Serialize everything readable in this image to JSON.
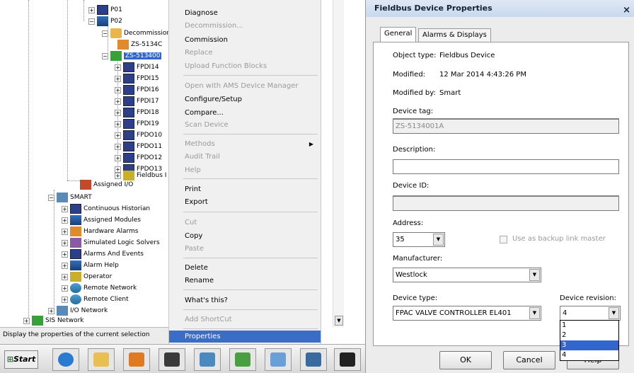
{
  "tree": {
    "items": [
      {
        "label": "P01",
        "icon": "computer-icon"
      },
      {
        "label": "P02",
        "icon": "controller-icon"
      },
      {
        "label": "Decommission",
        "icon": "folder-icon"
      },
      {
        "label": "ZS-5134C",
        "icon": "device-icon"
      },
      {
        "label": "ZS-513400",
        "icon": "device-icon"
      },
      {
        "label": "FPDI14",
        "icon": "function-block-icon"
      },
      {
        "label": "FPDI15",
        "icon": "function-block-icon"
      },
      {
        "label": "FPDI16",
        "icon": "function-block-icon"
      },
      {
        "label": "FPDI17",
        "icon": "function-block-icon"
      },
      {
        "label": "FPDI18",
        "icon": "function-block-icon"
      },
      {
        "label": "FPDI19",
        "icon": "function-block-icon"
      },
      {
        "label": "FPDO10",
        "icon": "function-block-icon"
      },
      {
        "label": "FPDO11",
        "icon": "function-block-icon"
      },
      {
        "label": "FPDO12",
        "icon": "function-block-icon"
      },
      {
        "label": "FPDO13",
        "icon": "function-block-icon"
      },
      {
        "label": "Fieldbus I",
        "icon": "fieldbus-icon"
      },
      {
        "label": "Assigned I/O",
        "icon": "assigned-io-icon"
      },
      {
        "label": "SMART",
        "icon": "node-icon"
      },
      {
        "label": "Continuous Historian",
        "icon": "historian-icon"
      },
      {
        "label": "Assigned Modules",
        "icon": "modules-icon"
      },
      {
        "label": "Hardware Alarms",
        "icon": "hardware-alarm-icon"
      },
      {
        "label": "Simulated Logic Solvers",
        "icon": "logic-solver-icon"
      },
      {
        "label": "Alarms And Events",
        "icon": "alarms-events-icon"
      },
      {
        "label": "Alarm Help",
        "icon": "alarm-help-icon"
      },
      {
        "label": "Operator",
        "icon": "operator-icon"
      },
      {
        "label": "Remote Network",
        "icon": "remote-network-icon"
      },
      {
        "label": "Remote Client",
        "icon": "remote-client-icon"
      },
      {
        "label": "I/O Network",
        "icon": "io-network-icon"
      },
      {
        "label": "SIS Network",
        "icon": "sis-network-icon"
      }
    ]
  },
  "context_menu": {
    "items": [
      {
        "label": "Diagnose",
        "enabled": true
      },
      {
        "label": "Decommission...",
        "enabled": false
      },
      {
        "label": "Commission",
        "enabled": true
      },
      {
        "label": "Replace",
        "enabled": false
      },
      {
        "label": "Upload Function Blocks",
        "enabled": false
      },
      {
        "label": "Open with AMS Device Manager",
        "enabled": false
      },
      {
        "label": "Configure/Setup",
        "enabled": true
      },
      {
        "label": "Compare...",
        "enabled": true
      },
      {
        "label": "Scan Device",
        "enabled": false
      },
      {
        "label": "Methods",
        "enabled": false
      },
      {
        "label": "Audit Trail",
        "enabled": false
      },
      {
        "label": "Help",
        "enabled": false
      },
      {
        "label": "Print",
        "enabled": true
      },
      {
        "label": "Export",
        "enabled": true
      },
      {
        "label": "Cut",
        "enabled": false
      },
      {
        "label": "Copy",
        "enabled": true
      },
      {
        "label": "Paste",
        "enabled": false
      },
      {
        "label": "Delete",
        "enabled": true
      },
      {
        "label": "Rename",
        "enabled": true
      },
      {
        "label": "What's this?",
        "enabled": true
      },
      {
        "label": "Add ShortCut",
        "enabled": false
      },
      {
        "label": "Properties",
        "enabled": true,
        "highlighted": true
      }
    ],
    "submenu_arrow": "▶"
  },
  "status_bar": {
    "text": "Display the properties of the current selection"
  },
  "taskbar": {
    "start_label": "Start",
    "buttons": [
      {
        "icon": "internet-explorer-icon"
      },
      {
        "icon": "file-explorer-icon"
      },
      {
        "icon": "media-player-icon"
      },
      {
        "icon": "delta-v-explorer-icon"
      },
      {
        "icon": "control-studio-icon"
      },
      {
        "icon": "diagnostics-icon"
      },
      {
        "icon": "ams-device-manager-icon"
      },
      {
        "icon": "network-icon"
      },
      {
        "icon": "trend-icon"
      }
    ]
  },
  "dialog": {
    "title": "Fieldbus Device Properties",
    "close_glyph": "×",
    "tabs": [
      "General",
      "Alarms & Displays"
    ],
    "object_type_label": "Object type:",
    "object_type_value": "Fieldbus Device",
    "modified_label": "Modified:",
    "modified_value": "12 Mar 2014 4:43:26 PM",
    "modified_by_label": "Modified by:",
    "modified_by_value": "Smart",
    "device_tag_label": "Device tag:",
    "device_tag_value": "ZS-5134001A",
    "description_label": "Description:",
    "description_value": "",
    "device_id_label": "Device ID:",
    "device_id_value": "",
    "address_label": "Address:",
    "address_value": "35",
    "backup_link_master_label": "Use as backup link master",
    "manufacturer_label": "Manufacturer:",
    "manufacturer_value": "Westlock",
    "device_type_label": "Device type:",
    "device_type_value": "FPAC VALVE CONTROLLER EL401",
    "device_revision_label": "Device revision:",
    "device_revision_value": "4",
    "device_revision_options": [
      "1",
      "2",
      "3",
      "4"
    ],
    "device_revision_highlighted": "3",
    "ok_label": "OK",
    "cancel_label": "Cancel",
    "help_label": "Help",
    "dropdown_glyph": "▼"
  }
}
